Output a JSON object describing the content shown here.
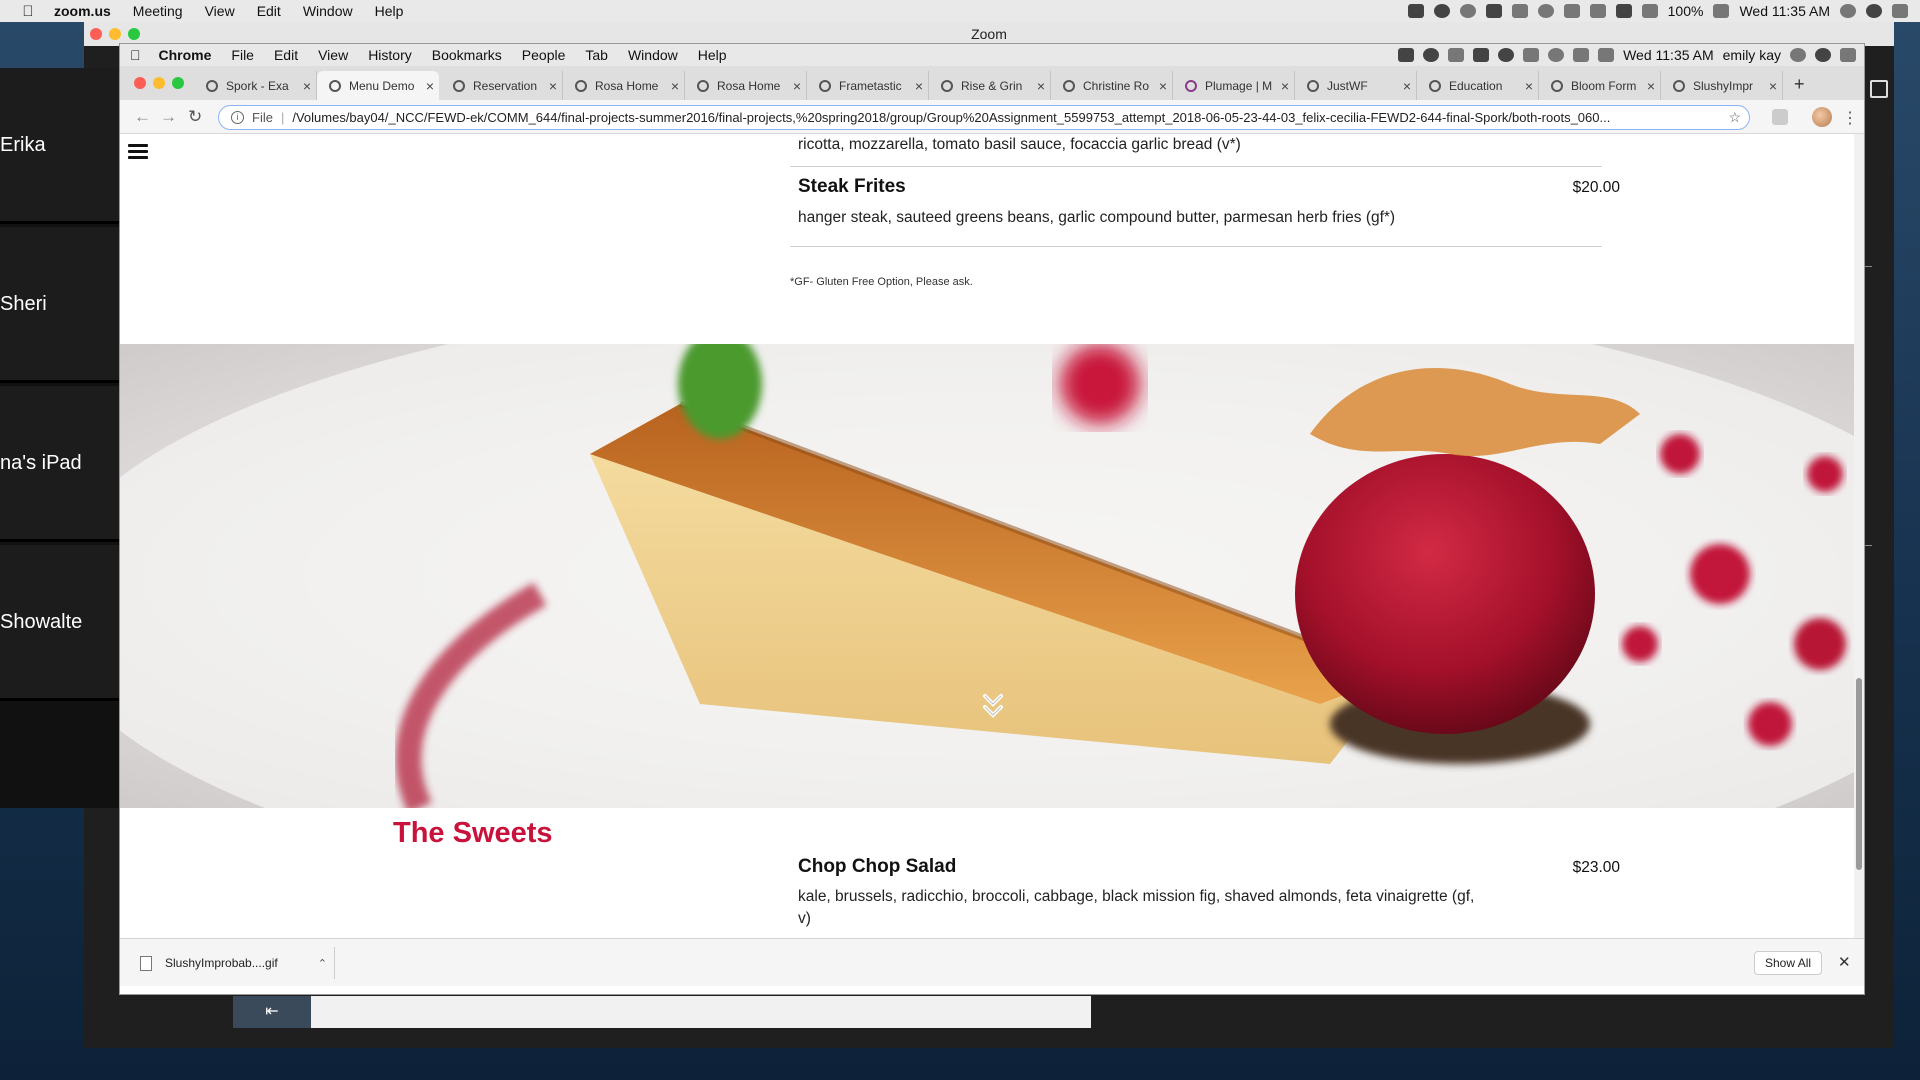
{
  "os_menubar": {
    "app": "zoom.us",
    "items": [
      "Meeting",
      "View",
      "Edit",
      "Window",
      "Help"
    ],
    "battery": "100%",
    "clock": "Wed 11:35 AM"
  },
  "zoom": {
    "title": "Zoom",
    "participants": [
      "Erika",
      "Sheri",
      "na's iPad",
      "Showalte"
    ]
  },
  "chrome_menubar": {
    "app": "Chrome",
    "items": [
      "File",
      "Edit",
      "View",
      "History",
      "Bookmarks",
      "People",
      "Tab",
      "Window",
      "Help"
    ],
    "clock": "Wed 11:35 AM",
    "user": "emily kay"
  },
  "tabs": [
    {
      "label": "Spork - Exa"
    },
    {
      "label": "Menu Demo"
    },
    {
      "label": "Reservation"
    },
    {
      "label": "Rosa Home"
    },
    {
      "label": "Rosa Home"
    },
    {
      "label": "Frametastic"
    },
    {
      "label": "Rise & Grin"
    },
    {
      "label": "Christine Ro"
    },
    {
      "label": "Plumage | M"
    },
    {
      "label": "JustWF"
    },
    {
      "label": "Education"
    },
    {
      "label": "Bloom Form"
    },
    {
      "label": "SlushyImpr"
    }
  ],
  "omnibox": {
    "scheme": "File",
    "url": "/Volumes/bay04/_NCC/FEWD-ek/COMM_644/final-projects-summer2016/final-projects,%20spring2018/group/Group%20Assignment_5599753_attempt_2018-06-05-23-44-03_felix-cecilia-FEWD2-644-final-Spork/both-roots_060..."
  },
  "menu": {
    "prev_desc": "ricotta, mozzarella, tomato basil sauce, focaccia garlic bread (v*)",
    "steak": {
      "title": "Steak Frites",
      "price": "$20.00",
      "desc": "hanger steak, sauteed greens beans, garlic compound butter, parmesan herb fries (gf*)"
    },
    "note": "*GF- Gluten Free Option, Please ask.",
    "section_title": "The Sweets",
    "salad": {
      "title": "Chop Chop Salad",
      "price": "$23.00",
      "desc_line1": "kale, brussels, radicchio, broccoli, cabbage, black mission fig, shaved almonds, feta vinaigrette (gf,",
      "desc_line2": "v)"
    }
  },
  "downloads": {
    "file": "SlushyImprobab....gif",
    "show_all": "Show All"
  },
  "colors": {
    "accent_red": "#c9123b",
    "focus_ring": "#8ab4f8"
  }
}
